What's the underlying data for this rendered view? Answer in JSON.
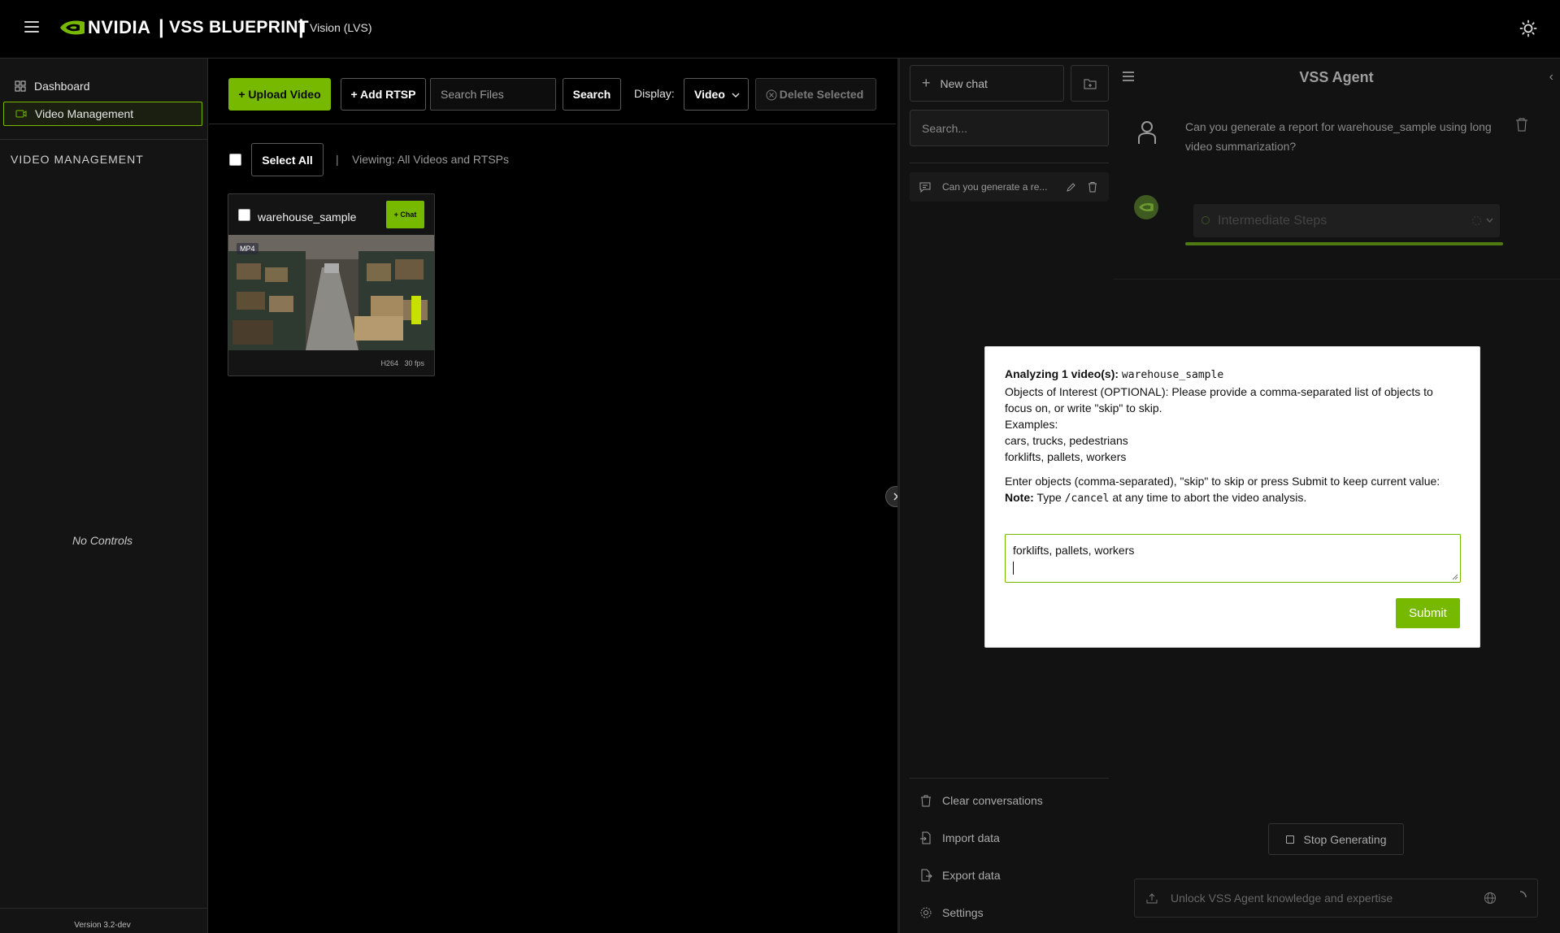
{
  "header": {
    "logo_text": "NVIDIA",
    "separator": "|",
    "title": "VSS BLUEPRINT",
    "subtitle": "Vision (LVS)"
  },
  "sidebar": {
    "items": [
      {
        "label": "Dashboard",
        "icon": "grid-icon"
      },
      {
        "label": "Video Management",
        "icon": "video-icon",
        "active": true
      }
    ],
    "section_title": "VIDEO MANAGEMENT",
    "no_controls": "No Controls",
    "version": "Version 3.2-dev"
  },
  "toolbar": {
    "upload_label": "+ Upload Video",
    "rtsp_label": "+ Add RTSP",
    "search_placeholder": "Search Files",
    "search_label": "Search",
    "display_label": "Display:",
    "display_value": "Video",
    "delete_label": "Delete Selected"
  },
  "selection": {
    "select_all_label": "Select All",
    "separator": "|",
    "viewing_text": "Viewing: All Videos and RTSPs"
  },
  "videos": [
    {
      "name": "warehouse_sample",
      "chat_label": "+ Chat",
      "format": "MP4",
      "codec": "H264",
      "fps": "30 fps"
    }
  ],
  "history": {
    "new_chat_label": "New chat",
    "search_placeholder": "Search...",
    "conversations": [
      "Can you generate a re..."
    ],
    "actions": [
      {
        "label": "Clear conversations",
        "icon": "trash-icon"
      },
      {
        "label": "Import data",
        "icon": "file-import-icon"
      },
      {
        "label": "Export data",
        "icon": "file-export-icon"
      },
      {
        "label": "Settings",
        "icon": "gear-icon"
      }
    ]
  },
  "agent": {
    "title": "VSS Agent",
    "user_message": "Can you generate a report for warehouse_sample using long video summarization?",
    "steps_label": "Intermediate Steps",
    "stop_label": "Stop Generating",
    "composer_placeholder": "Unlock VSS Agent knowledge and expertise"
  },
  "modal": {
    "analyzing_prefix": "Analyzing 1 video(s):",
    "analyzing_video": "warehouse_sample",
    "prompt_line": "Objects of Interest (OPTIONAL): Please provide a comma-separated list of objects to focus on, or write \"skip\" to skip.",
    "examples_label": "Examples:",
    "example_1": "cars, trucks, pedestrians",
    "example_2": "forklifts, pallets, workers",
    "instruction": "Enter objects (comma-separated), \"skip\" to skip or press Submit to keep current value:",
    "note_label": "Note:",
    "note_pre": "Type",
    "note_cmd": "/cancel",
    "note_post": "at any time to abort the video analysis.",
    "input_value": "forklifts, pallets, workers",
    "submit_label": "Submit"
  },
  "colors": {
    "accent": "#76b900",
    "background": "#000000",
    "panel": "#121212"
  }
}
